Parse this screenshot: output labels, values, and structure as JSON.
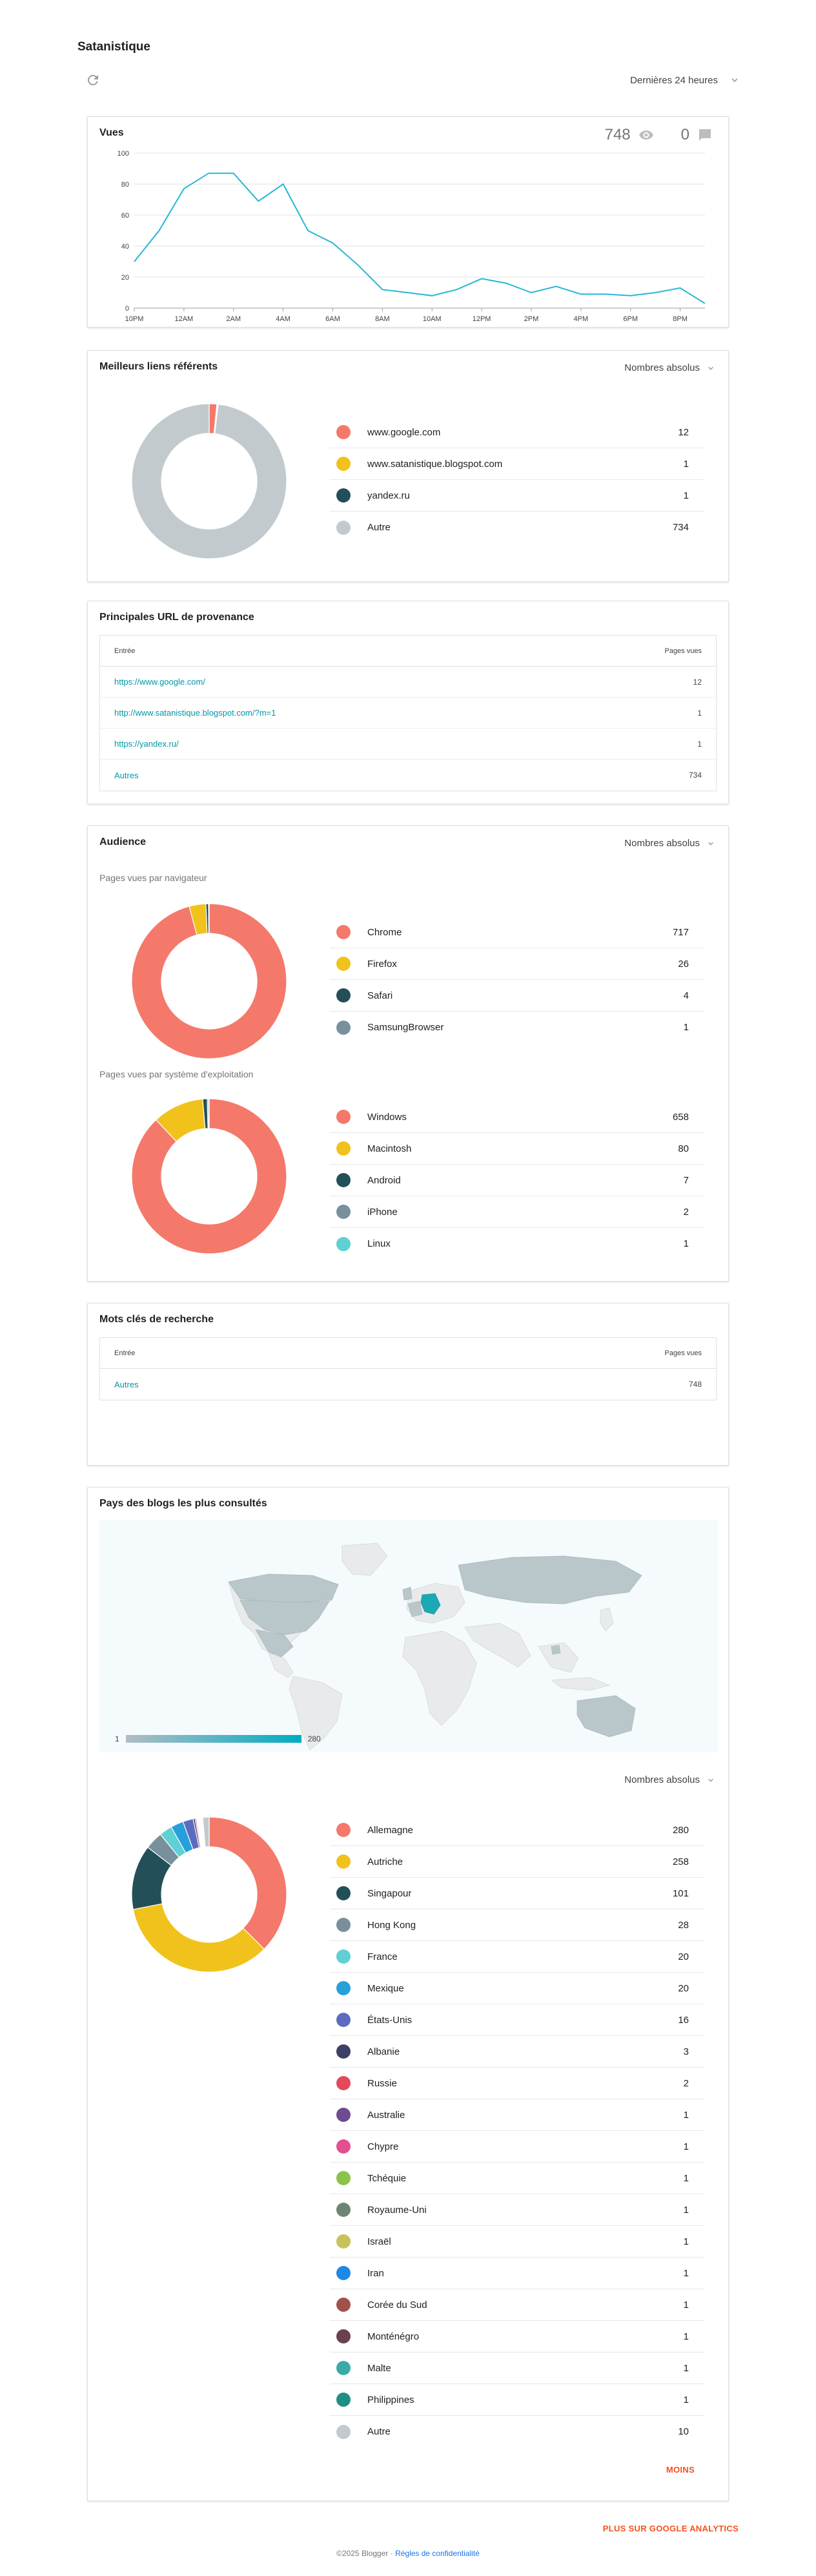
{
  "header": {
    "title": "Satanistique",
    "period": "Dernières 24 heures"
  },
  "views": {
    "title": "Vues",
    "total": "748",
    "secondary_count": "0",
    "chart_data": {
      "type": "line",
      "color": "#26b7d4",
      "x": [
        "10PM",
        "11PM",
        "12AM",
        "1AM",
        "2AM",
        "3AM",
        "4AM",
        "5AM",
        "6AM",
        "7AM",
        "8AM",
        "9AM",
        "10AM",
        "11AM",
        "12PM",
        "1PM",
        "2PM",
        "3PM",
        "4PM",
        "5PM",
        "6PM",
        "7PM",
        "8PM",
        "9PM"
      ],
      "values": [
        30,
        50,
        77,
        87,
        87,
        69,
        80,
        50,
        42,
        28,
        12,
        10,
        8,
        12,
        19,
        16,
        10,
        14,
        9,
        9,
        8,
        10,
        13,
        3
      ],
      "tick_labels": [
        "10PM",
        "12AM",
        "2AM",
        "4AM",
        "6AM",
        "8AM",
        "10AM",
        "12PM",
        "2PM",
        "4PM",
        "6PM",
        "8PM"
      ],
      "yticks": [
        0,
        20,
        40,
        60,
        80,
        100
      ],
      "ylim": [
        0,
        100
      ],
      "grid": true
    }
  },
  "referrers": {
    "title": "Meilleurs liens référents",
    "selector": "Nombres absolus",
    "items": [
      {
        "label": "www.google.com",
        "value": "12",
        "n": 12,
        "color": "#f4796a"
      },
      {
        "label": "www.satanistique.blogspot.com",
        "value": "1",
        "n": 1,
        "color": "#f1c21b"
      },
      {
        "label": "yandex.ru",
        "value": "1",
        "n": 1,
        "color": "#234f58"
      },
      {
        "label": "Autre",
        "value": "734",
        "n": 734,
        "color": "#c3cace"
      }
    ]
  },
  "urls": {
    "title": "Principales URL de provenance",
    "col_entry": "Entrée",
    "col_views": "Pages vues",
    "rows": [
      {
        "url": "https://www.google.com/",
        "views": "12"
      },
      {
        "url": "http://www.satanistique.blogspot.com/?m=1",
        "views": "1"
      },
      {
        "url": "https://yandex.ru/",
        "views": "1"
      },
      {
        "url": "Autres",
        "views": "734"
      }
    ]
  },
  "audience": {
    "title": "Audience",
    "selector": "Nombres absolus",
    "browsers_label": "Pages vues par navigateur",
    "browsers": [
      {
        "label": "Chrome",
        "value": "717",
        "n": 717,
        "color": "#f4796a"
      },
      {
        "label": "Firefox",
        "value": "26",
        "n": 26,
        "color": "#f1c21b"
      },
      {
        "label": "Safari",
        "value": "4",
        "n": 4,
        "color": "#234f58"
      },
      {
        "label": "SamsungBrowser",
        "value": "1",
        "n": 1,
        "color": "#78909c"
      }
    ],
    "os_label": "Pages vues par système d'exploitation",
    "os": [
      {
        "label": "Windows",
        "value": "658",
        "n": 658,
        "color": "#f4796a"
      },
      {
        "label": "Macintosh",
        "value": "80",
        "n": 80,
        "color": "#f1c21b"
      },
      {
        "label": "Android",
        "value": "7",
        "n": 7,
        "color": "#234f58"
      },
      {
        "label": "iPhone",
        "value": "2",
        "n": 2,
        "color": "#78909c"
      },
      {
        "label": "Linux",
        "value": "1",
        "n": 1,
        "color": "#5fd0d3"
      }
    ]
  },
  "keywords": {
    "title": "Mots clés de recherche",
    "col_entry": "Entrée",
    "col_views": "Pages vues",
    "rows": [
      {
        "term": "Autres",
        "views": "748"
      }
    ]
  },
  "countries": {
    "title": "Pays des blogs les plus consultés",
    "scale_min": "1",
    "scale_max": "280",
    "selector": "Nombres absolus",
    "items": [
      {
        "label": "Allemagne",
        "value": "280",
        "n": 280,
        "color": "#f4796a"
      },
      {
        "label": "Autriche",
        "value": "258",
        "n": 258,
        "color": "#f1c21b"
      },
      {
        "label": "Singapour",
        "value": "101",
        "n": 101,
        "color": "#234f58"
      },
      {
        "label": "Hong Kong",
        "value": "28",
        "n": 28,
        "color": "#78909c"
      },
      {
        "label": "France",
        "value": "20",
        "n": 20,
        "color": "#5fd0d3"
      },
      {
        "label": "Mexique",
        "value": "20",
        "n": 20,
        "color": "#26a0da"
      },
      {
        "label": "États-Unis",
        "value": "16",
        "n": 16,
        "color": "#5c6bc0"
      },
      {
        "label": "Albanie",
        "value": "3",
        "n": 3,
        "color": "#3c3f66"
      },
      {
        "label": "Russie",
        "value": "2",
        "n": 2,
        "color": "#e5485d"
      },
      {
        "label": "Australie",
        "value": "1",
        "n": 1,
        "color": "#6d4c8f"
      },
      {
        "label": "Chypre",
        "value": "1",
        "n": 1,
        "color": "#e2508f"
      },
      {
        "label": "Tchéquie",
        "value": "1",
        "n": 1,
        "color": "#8bc34a"
      },
      {
        "label": "Royaume-Uni",
        "value": "1",
        "n": 1,
        "color": "#6d8674"
      },
      {
        "label": "Israël",
        "value": "1",
        "n": 1,
        "color": "#c8c25a"
      },
      {
        "label": "Iran",
        "value": "1",
        "n": 1,
        "color": "#1e88e5"
      },
      {
        "label": "Corée du Sud",
        "value": "1",
        "n": 1,
        "color": "#a0524a"
      },
      {
        "label": "Monténégro",
        "value": "1",
        "n": 1,
        "color": "#6b4152"
      },
      {
        "label": "Malte",
        "value": "1",
        "n": 1,
        "color": "#3aaba8"
      },
      {
        "label": "Philippines",
        "value": "1",
        "n": 1,
        "color": "#1f8f86"
      },
      {
        "label": "Autre",
        "value": "10",
        "n": 10,
        "color": "#c3cace"
      }
    ],
    "less": "MOINS"
  },
  "more_analytics": "PLUS SUR GOOGLE ANALYTICS",
  "footer": {
    "copyright": "©2025 Blogger",
    "separator": " · ",
    "privacy": "Règles de confidentialité"
  }
}
